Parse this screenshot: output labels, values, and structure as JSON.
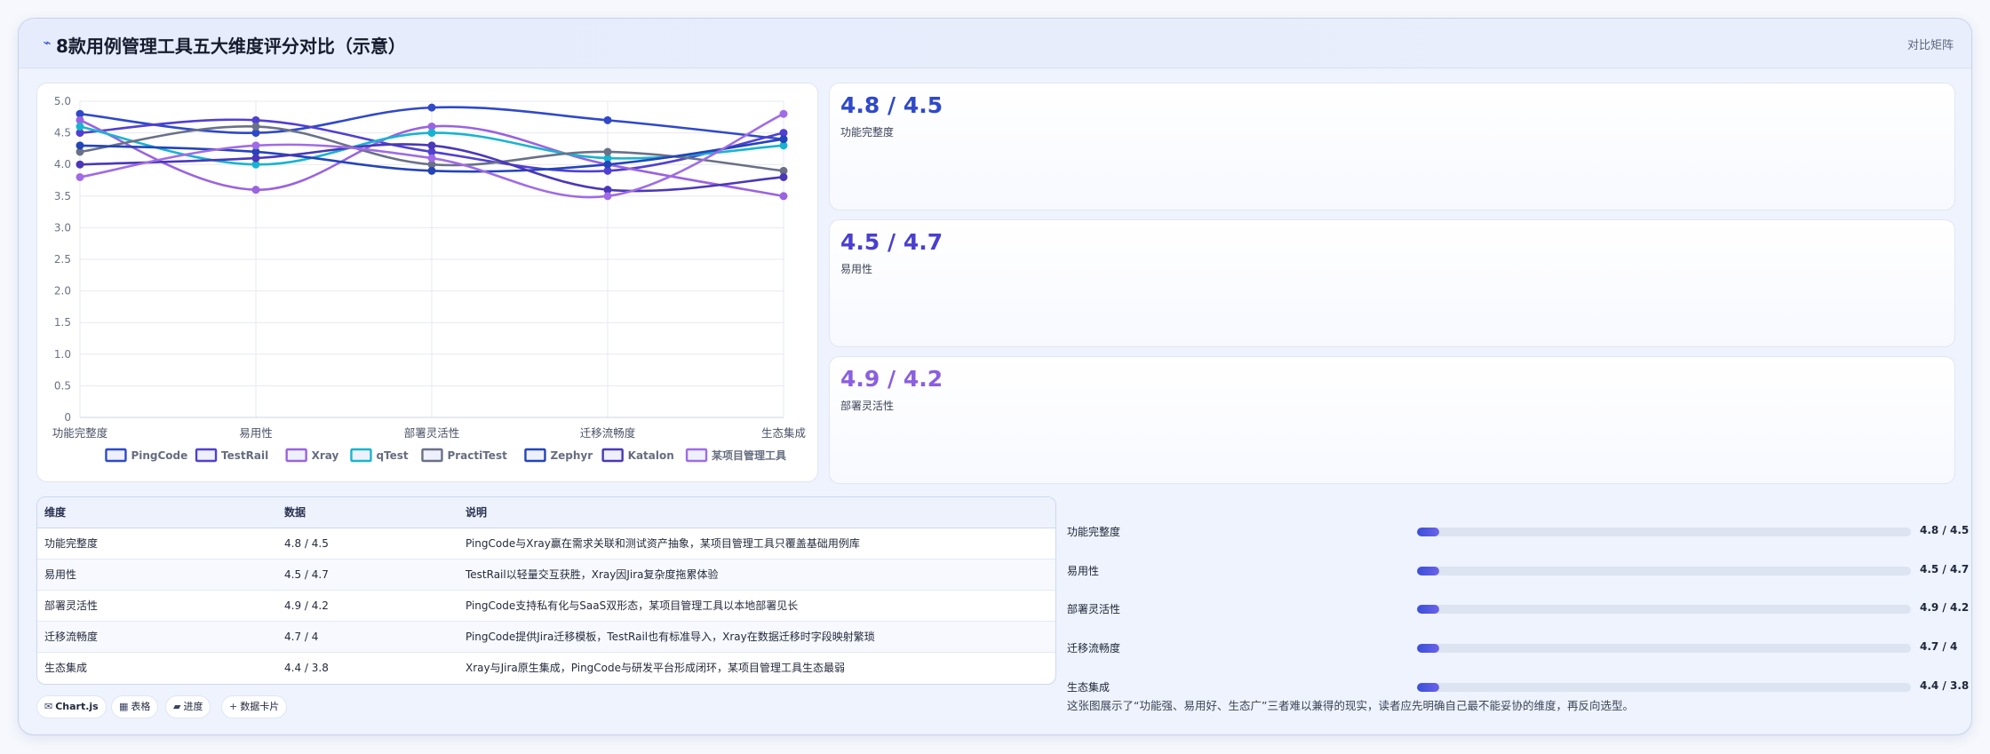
{
  "header": {
    "icon": "chart-line-icon",
    "title": "8款用例管理工具五大维度评分对比（示意）",
    "badge": "对比矩阵"
  },
  "chart_data": {
    "type": "line",
    "categories": [
      "功能完整度",
      "易用性",
      "部署灵活性",
      "迁移流畅度",
      "生态集成"
    ],
    "ylim": [
      0,
      5
    ],
    "yticks": [
      "0",
      "0.5",
      "1.0",
      "1.5",
      "2.0",
      "2.5",
      "3.0",
      "3.5",
      "4.0",
      "4.5",
      "5.0"
    ],
    "grid": true,
    "legend_position": "bottom",
    "series": [
      {
        "name": "PingCode",
        "color": "#2f49c9",
        "values": [
          4.8,
          4.5,
          4.9,
          4.7,
          4.4
        ]
      },
      {
        "name": "TestRail",
        "color": "#5140d0",
        "values": [
          4.5,
          4.7,
          4.2,
          3.9,
          4.5
        ]
      },
      {
        "name": "Xray",
        "color": "#9a63e0",
        "values": [
          4.7,
          3.6,
          4.6,
          4.0,
          3.5
        ]
      },
      {
        "name": "qTest",
        "color": "#18b4cf",
        "values": [
          4.6,
          4.0,
          4.5,
          4.1,
          4.3
        ]
      },
      {
        "name": "PractiTest",
        "color": "#6a7187",
        "values": [
          4.2,
          4.6,
          4.0,
          4.2,
          3.9
        ]
      },
      {
        "name": "Zephyr",
        "color": "#2444b8",
        "values": [
          4.3,
          4.2,
          3.9,
          4.0,
          4.4
        ]
      },
      {
        "name": "Katalon",
        "color": "#4a38b8",
        "values": [
          4.0,
          4.1,
          4.3,
          3.6,
          3.8
        ]
      },
      {
        "name": "某项目管理工具",
        "color": "#a06be6",
        "values": [
          3.8,
          4.3,
          4.1,
          3.5,
          4.8
        ]
      }
    ]
  },
  "stats": [
    {
      "value": "4.8 / 4.5",
      "label": "功能完整度",
      "color": "#2f49c9"
    },
    {
      "value": "4.5 / 4.7",
      "label": "易用性",
      "color": "#4a3fcf"
    },
    {
      "value": "4.9 / 4.2",
      "label": "部署灵活性",
      "color": "#8a5fe0"
    }
  ],
  "table": {
    "headers": [
      "维度",
      "数据",
      "说明"
    ],
    "rows": [
      [
        "功能完整度",
        "4.8 / 4.5",
        "PingCode与Xray赢在需求关联和测试资产抽象，某项目管理工具只覆盖基础用例库"
      ],
      [
        "易用性",
        "4.5 / 4.7",
        "TestRail以轻量交互获胜，Xray因Jira复杂度拖累体验"
      ],
      [
        "部署灵活性",
        "4.9 / 4.2",
        "PingCode支持私有化与SaaS双形态，某项目管理工具以本地部署见长"
      ],
      [
        "迁移流畅度",
        "4.7 / 4",
        "PingCode提供Jira迁移模板，TestRail也有标准导入，Xray在数据迁移时字段映射繁琐"
      ],
      [
        "生态集成",
        "4.4 / 3.8",
        "Xray与Jira原生集成，PingCode与研发平台形成闭环，某项目管理工具生态最弱"
      ]
    ]
  },
  "chips": [
    {
      "icon": "chart-icon",
      "glyph": "✉",
      "label": "Chart.js",
      "bold": true
    },
    {
      "icon": "table-icon",
      "glyph": "▦",
      "label": "表格"
    },
    {
      "icon": "progress-icon",
      "glyph": "▰",
      "label": "进度"
    },
    {
      "icon": "card-icon",
      "glyph": "+",
      "label": "数据卡片"
    }
  ],
  "bars": [
    {
      "label": "功能完整度",
      "value": "4.8 / 4.5",
      "fill": 0.045
    },
    {
      "label": "易用性",
      "value": "4.5 / 4.7",
      "fill": 0.045
    },
    {
      "label": "部署灵活性",
      "value": "4.9 / 4.2",
      "fill": 0.045
    },
    {
      "label": "迁移流畅度",
      "value": "4.7 / 4",
      "fill": 0.045
    },
    {
      "label": "生态集成",
      "value": "4.4 / 3.8",
      "fill": 0.045
    }
  ],
  "note": "这张图展示了“功能强、易用好、生态广”三者难以兼得的现实，读者应先明确自己最不能妥协的维度，再反向选型。"
}
